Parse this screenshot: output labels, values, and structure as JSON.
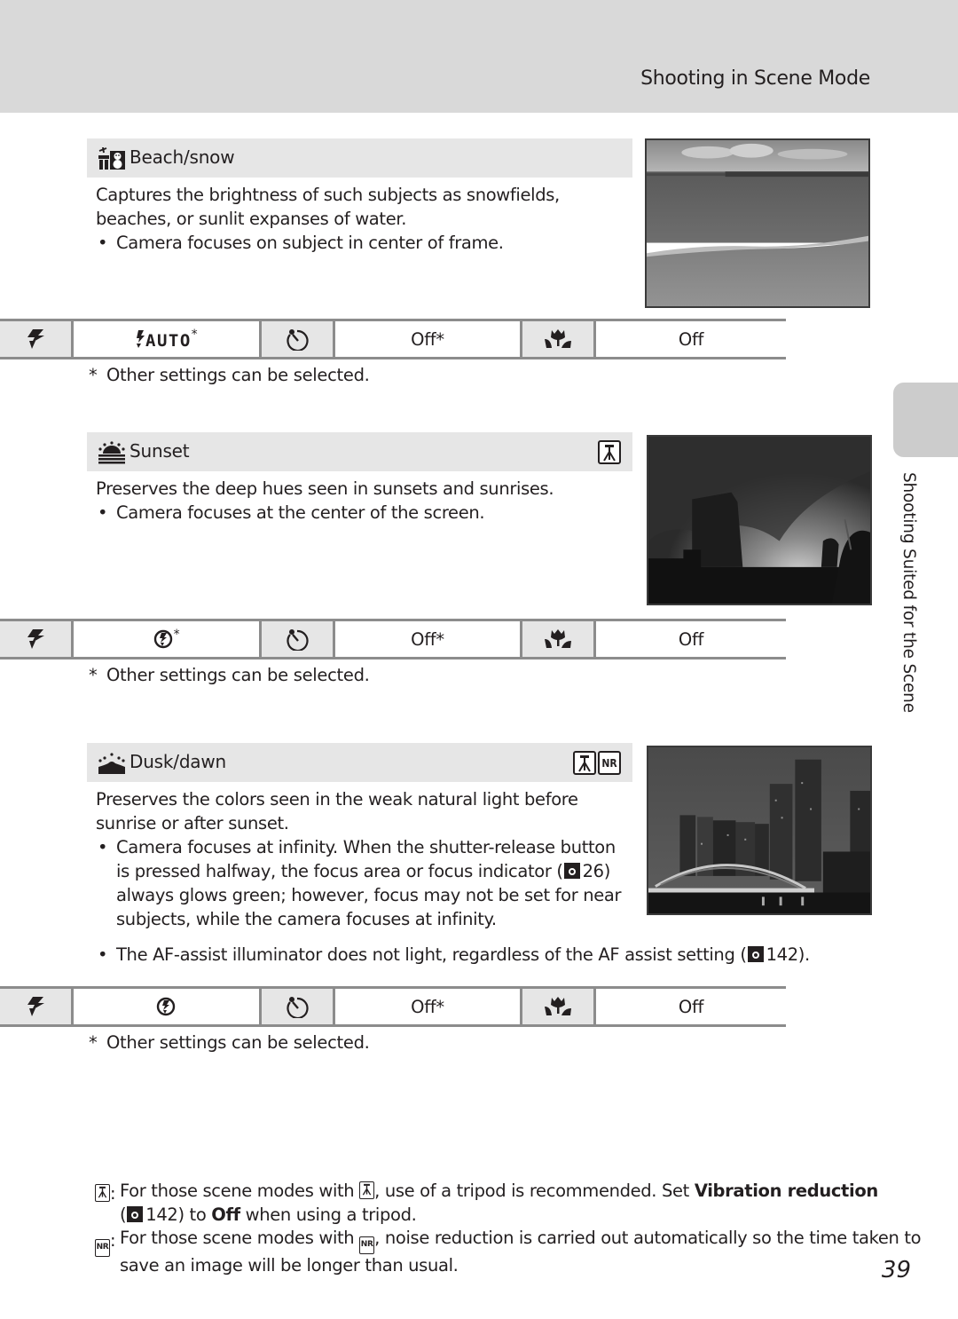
{
  "header": {
    "title": "Shooting in Scene Mode"
  },
  "side_tab": {
    "label": "Shooting Suited for the Scene"
  },
  "sections": [
    {
      "icon": "beach-snow-icon",
      "title": "Beach/snow",
      "badges": [],
      "description": "Captures the brightness of such subjects as snowfields, beaches, or sunlit expanses of water.",
      "bullets": [
        "Camera focuses on subject in center of frame."
      ],
      "photo": "beach-photo",
      "settings": {
        "flash_icon": "flash-mode-icon",
        "flash_value_icon": "flash-auto-icon",
        "flash_value_asterisk": "*",
        "timer_icon": "self-timer-icon",
        "timer_value": "Off*",
        "macro_icon": "macro-mode-icon",
        "macro_value": "Off"
      },
      "footnote_mark": "*",
      "footnote": "Other settings can be selected."
    },
    {
      "icon": "sunset-icon",
      "title": "Sunset",
      "badges": [
        "tripod-icon"
      ],
      "description": "Preserves the deep hues seen in sunsets and sunrises.",
      "bullets": [
        "Camera focuses at the center of the screen."
      ],
      "photo": "sunset-photo",
      "settings": {
        "flash_icon": "flash-mode-icon",
        "flash_value_icon": "flash-off-icon",
        "flash_value_asterisk": "*",
        "timer_icon": "self-timer-icon",
        "timer_value": "Off*",
        "macro_icon": "macro-mode-icon",
        "macro_value": "Off"
      },
      "footnote_mark": "*",
      "footnote": "Other settings can be selected."
    },
    {
      "icon": "dusk-dawn-icon",
      "title": "Dusk/dawn",
      "badges": [
        "tripod-icon",
        "noise-reduction-icon"
      ],
      "badge_nr_text": "NR",
      "description": "Preserves the colors seen in the weak natural light before sunrise or after sunset.",
      "bullet1_a": "Camera focuses at infinity. When the shutter-release button is pressed halfway, the focus area or focus indicator (",
      "bullet1_ref": "26",
      "bullet1_b": ") always glows green; however, focus may not be set for near subjects, while the camera focuses at infinity.",
      "bullet2_a": "The AF-assist illuminator does not light, regardless of the AF assist setting (",
      "bullet2_ref": "142",
      "bullet2_b": ").",
      "photo": "dusk-photo",
      "settings": {
        "flash_icon": "flash-mode-icon",
        "flash_value_icon": "flash-off-icon",
        "flash_value_asterisk": "",
        "timer_icon": "self-timer-icon",
        "timer_value": "Off*",
        "macro_icon": "macro-mode-icon",
        "macro_value": "Off"
      },
      "footnote_mark": "*",
      "footnote": "Other settings can be selected."
    }
  ],
  "notes": {
    "tripod": {
      "sep": ":",
      "t1": "For those scene modes with ",
      "t2": ", use of a tripod is recommended. Set ",
      "bold1": "Vibration reduction",
      "t3": "(",
      "ref": "142",
      "t4": ") to ",
      "bold2": "Off",
      "t5": " when using a tripod."
    },
    "nr": {
      "badge": "NR",
      "sep": ":",
      "t1": "For those scene modes with ",
      "t2": ", noise reduction is carried out automatically so the time taken to save an image will be longer than usual."
    }
  },
  "page_number": "39"
}
